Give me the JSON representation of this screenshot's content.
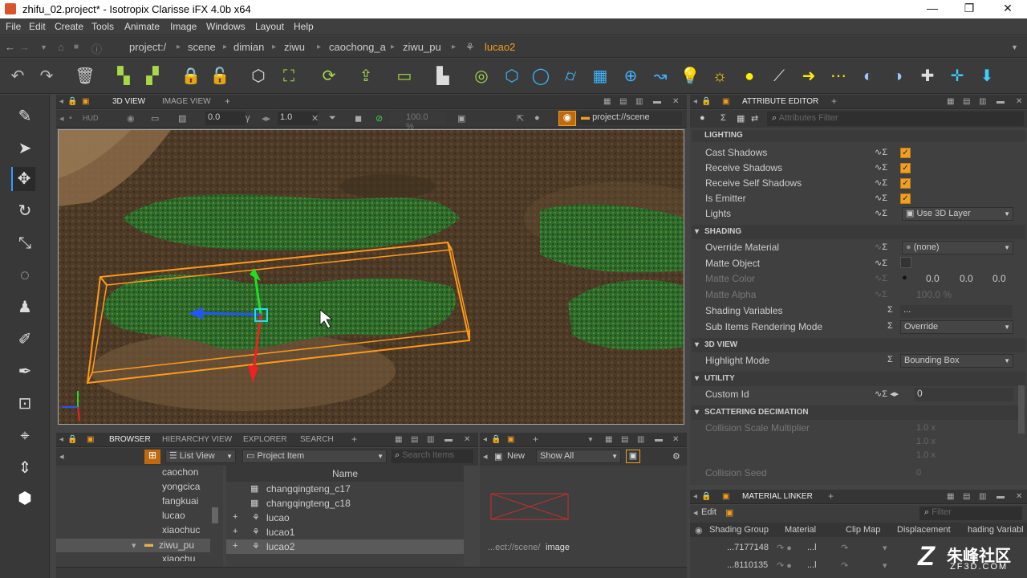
{
  "window": {
    "title": "zhifu_02.project* - Isotropix Clarisse iFX 4.0b x64",
    "min": "—",
    "max": "❐",
    "close": "✕"
  },
  "menu": [
    "File",
    "Edit",
    "Create",
    "Tools",
    "Animate",
    "Image",
    "Windows",
    "Layout",
    "Help"
  ],
  "path": {
    "items": [
      "project:/",
      "scene",
      "dimian",
      "ziwu",
      "caochong_a",
      "ziwu_pu"
    ],
    "current": "lucao2"
  },
  "viewport": {
    "tabs": [
      "3D VIEW",
      "IMAGE VIEW"
    ],
    "hud": "HUD",
    "field1": "0.0",
    "field2": "1.0",
    "zoom": "100.0 %",
    "context": "project://scene"
  },
  "attribute_editor": {
    "title": "ATTRIBUTE EDITOR",
    "filter_placeholder": "Attributes Filter",
    "sections": {
      "lighting": "LIGHTING",
      "shading": "SHADING",
      "view3d": "3D VIEW",
      "utility": "UTILITY",
      "scattering": "SCATTERING DECIMATION"
    },
    "rows": {
      "cast_shadows": "Cast Shadows",
      "receive_shadows": "Receive Shadows",
      "receive_self_shadows": "Receive Self Shadows",
      "is_emitter": "Is Emitter",
      "lights": "Lights",
      "lights_value": "Use 3D Layer",
      "override_material": "Override Material",
      "override_material_value": "(none)",
      "matte_object": "Matte Object",
      "matte_color": "Matte Color",
      "matte_color_r": "0.0",
      "matte_color_g": "0.0",
      "matte_color_b": "0.0",
      "matte_alpha": "Matte Alpha",
      "matte_alpha_value": "100.0 %",
      "shading_variables": "Shading Variables",
      "shading_variables_value": "...",
      "sub_items_mode": "Sub Items Rendering Mode",
      "sub_items_value": "Override",
      "highlight_mode": "Highlight Mode",
      "highlight_value": "Bounding Box",
      "custom_id": "Custom Id",
      "custom_id_value": "0",
      "collision_scale": "Collision Scale Multiplier",
      "collision_scale_x": "1.0 x",
      "collision_scale_y": "1.0 x",
      "collision_scale_z": "1.0 x",
      "collision_seed": "Collision Seed",
      "collision_seed_value": "0"
    }
  },
  "material_linker": {
    "title": "MATERIAL LINKER",
    "edit": "Edit",
    "filter_placeholder": "Filter",
    "columns": [
      "Shading Group",
      "Material",
      "Clip Map",
      "Displacement",
      "hading Variabl"
    ],
    "rows": [
      {
        "group": "...7177148",
        "material": "...l"
      },
      {
        "group": "...8110135",
        "material": "...l"
      }
    ]
  },
  "browser": {
    "tabs": [
      "BROWSER",
      "HIERARCHY VIEW",
      "EXPLORER",
      "SEARCH"
    ],
    "view_mode": "List View",
    "item_type": "Project Item",
    "search_placeholder": "Search Items",
    "column": "Name",
    "tree": [
      "caochon",
      "yongcica",
      "fangkuai",
      "lucao",
      "xiaochuc",
      "ziwu_pu",
      "xiaochu"
    ],
    "list": [
      "changqingteng_c17",
      "changqingteng_c18",
      "lucao",
      "lucao1",
      "lucao2"
    ]
  },
  "image_panel": {
    "new": "New",
    "show": "Show All",
    "path_prefix": "...ect://scene/",
    "path_name": "image"
  },
  "watermark": {
    "cn": "朱峰社区",
    "en": "ZF3D.COM"
  },
  "colors": {
    "accent": "#f0a020",
    "selection": "#ff9a1a",
    "bg": "#444444"
  }
}
